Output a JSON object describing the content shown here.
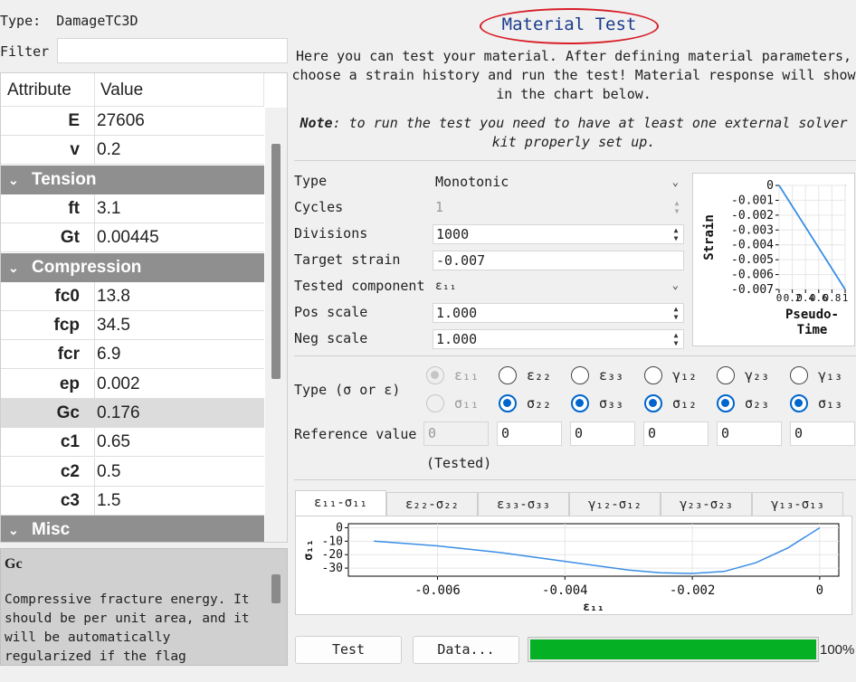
{
  "left": {
    "type_label": "Type:",
    "type_value": "DamageTC3D",
    "filter_label": "Filter",
    "table": {
      "col_attribute": "Attribute",
      "col_value": "Value",
      "rows": [
        {
          "kind": "prop",
          "key": "E",
          "value": "27606"
        },
        {
          "kind": "prop",
          "key": "v",
          "value": "0.2"
        },
        {
          "kind": "group",
          "label": "Tension"
        },
        {
          "kind": "prop",
          "key": "ft",
          "value": "3.1"
        },
        {
          "kind": "prop",
          "key": "Gt",
          "value": "0.00445"
        },
        {
          "kind": "group",
          "label": "Compression"
        },
        {
          "kind": "prop",
          "key": "fc0",
          "value": "13.8"
        },
        {
          "kind": "prop",
          "key": "fcp",
          "value": "34.5"
        },
        {
          "kind": "prop",
          "key": "fcr",
          "value": "6.9"
        },
        {
          "kind": "prop",
          "key": "ep",
          "value": "0.002"
        },
        {
          "kind": "prop",
          "key": "Gc",
          "value": "0.176",
          "selected": true
        },
        {
          "kind": "prop",
          "key": "c1",
          "value": "0.65"
        },
        {
          "kind": "prop",
          "key": "c2",
          "value": "0.5"
        },
        {
          "kind": "prop",
          "key": "c3",
          "value": "1.5"
        },
        {
          "kind": "group",
          "label": "Misc"
        }
      ]
    },
    "description": {
      "title": "Gc",
      "text": "Compressive fracture energy. It should be per unit area, and it will be automatically regularized if the flag"
    }
  },
  "right": {
    "title": "Material Test",
    "intro": "Here you can test your material. After defining material parameters, choose a strain history and run the test! Material response will show in the chart below.",
    "note_label": "Note",
    "note_text": ": to run the test you need to have at least one external solver kit properly set up.",
    "form": {
      "type_label": "Type",
      "type_value": "Monotonic",
      "cycles_label": "Cycles",
      "cycles_value": "1",
      "divisions_label": "Divisions",
      "divisions_value": "1000",
      "target_strain_label": "Target strain",
      "target_strain_value": "-0.007",
      "tested_component_label": "Tested component",
      "tested_component_value": "ε₁₁",
      "pos_scale_label": "Pos scale",
      "pos_scale_value": "1.000",
      "neg_scale_label": "Neg scale",
      "neg_scale_value": "1.000"
    },
    "type_sigma_eps_label": "Type (σ or ε)",
    "components": [
      {
        "eps": "ε₁₁",
        "sig": "σ₁₁",
        "eps_on": true,
        "sig_on": false,
        "disabled": true
      },
      {
        "eps": "ε₂₂",
        "sig": "σ₂₂",
        "eps_on": false,
        "sig_on": true,
        "disabled": false
      },
      {
        "eps": "ε₃₃",
        "sig": "σ₃₃",
        "eps_on": false,
        "sig_on": true,
        "disabled": false
      },
      {
        "eps": "γ₁₂",
        "sig": "σ₁₂",
        "eps_on": false,
        "sig_on": true,
        "disabled": false
      },
      {
        "eps": "γ₂₃",
        "sig": "σ₂₃",
        "eps_on": false,
        "sig_on": true,
        "disabled": false
      },
      {
        "eps": "γ₁₃",
        "sig": "σ₁₃",
        "eps_on": false,
        "sig_on": true,
        "disabled": false
      }
    ],
    "reference_value_label": "Reference value",
    "reference_values": [
      "0",
      "0",
      "0",
      "0",
      "0",
      "0"
    ],
    "tested_label": "(Tested)",
    "tabs": [
      "ε₁₁-σ₁₁",
      "ε₂₂-σ₂₂",
      "ε₃₃-σ₃₃",
      "γ₁₂-σ₁₂",
      "γ₂₃-σ₂₃",
      "γ₁₃-σ₁₃"
    ],
    "test_button": "Test",
    "data_button": "Data...",
    "progress_text": "100%",
    "progress_fraction": 1.0,
    "colors": {
      "accent": "#0066cc",
      "progress": "#06b025",
      "line": "#3a8ee6",
      "title_circle": "#d81e28"
    }
  },
  "chart_data": [
    {
      "type": "line",
      "xlabel": "Pseudo-Time",
      "ylabel": "Strain",
      "x": [
        0,
        1
      ],
      "y": [
        0,
        -0.007
      ],
      "xlim": [
        0,
        1
      ],
      "ylim": [
        -0.007,
        0
      ],
      "yticks": [
        "0",
        "-0.001",
        "-0.002",
        "-0.003",
        "-0.004",
        "-0.005",
        "-0.006",
        "-0.007"
      ],
      "xticks": [
        "0",
        "0.2",
        "0.4",
        "0.6",
        "0.8",
        "1"
      ],
      "grid": true
    },
    {
      "type": "line",
      "xlabel": "ε₁₁",
      "ylabel": "σ₁₁",
      "x": [
        -0.007,
        -0.006,
        -0.005,
        -0.004,
        -0.003,
        -0.0025,
        -0.002,
        -0.0015,
        -0.001,
        -0.0005,
        0
      ],
      "y": [
        -10,
        -13.5,
        -18.5,
        -25,
        -31.5,
        -33.5,
        -34,
        -32.5,
        -26,
        -15,
        0
      ],
      "xlim": [
        -0.0074,
        0.0003
      ],
      "ylim": [
        -36,
        3
      ],
      "xticks": [
        "-0.006",
        "-0.004",
        "-0.002",
        "0"
      ],
      "yticks": [
        "0",
        "-10",
        "-20",
        "-30"
      ],
      "grid": true
    }
  ]
}
